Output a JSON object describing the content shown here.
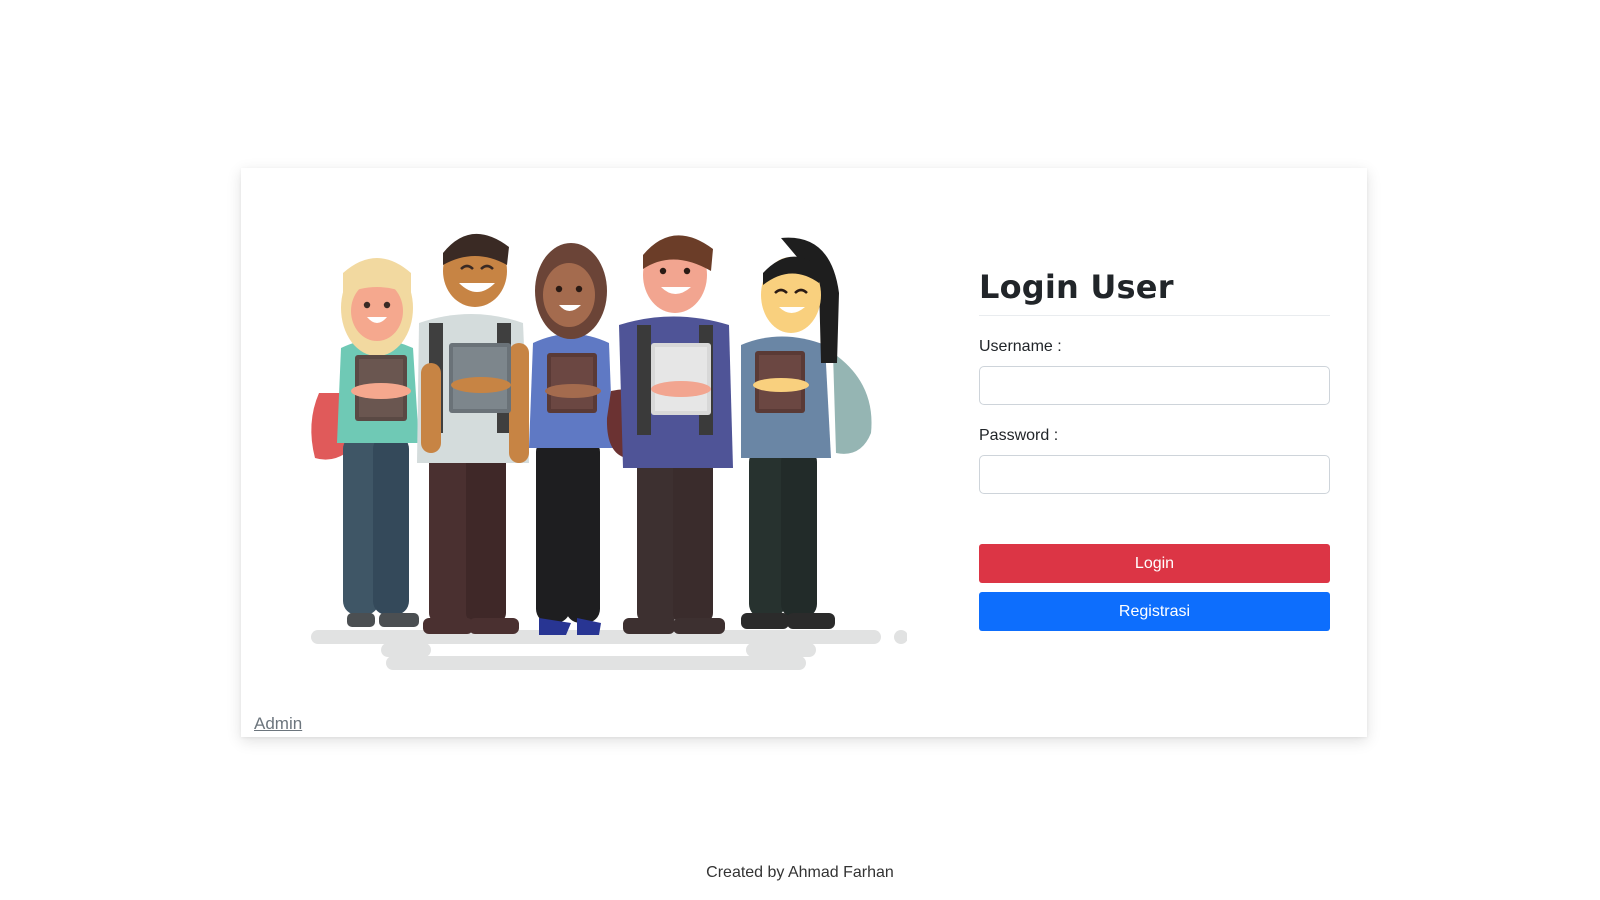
{
  "login_form": {
    "title": "Login User",
    "username_label": "Username :",
    "username_value": "",
    "password_label": "Password :",
    "password_value": "",
    "login_button": "Login",
    "register_button": "Registrasi"
  },
  "admin_link": "Admin",
  "footer": {
    "credit": "Created by Ahmad Farhan"
  },
  "colors": {
    "login_button": "#dc3545",
    "register_button": "#0d6efd"
  },
  "illustration": "group-of-students-holding-books"
}
